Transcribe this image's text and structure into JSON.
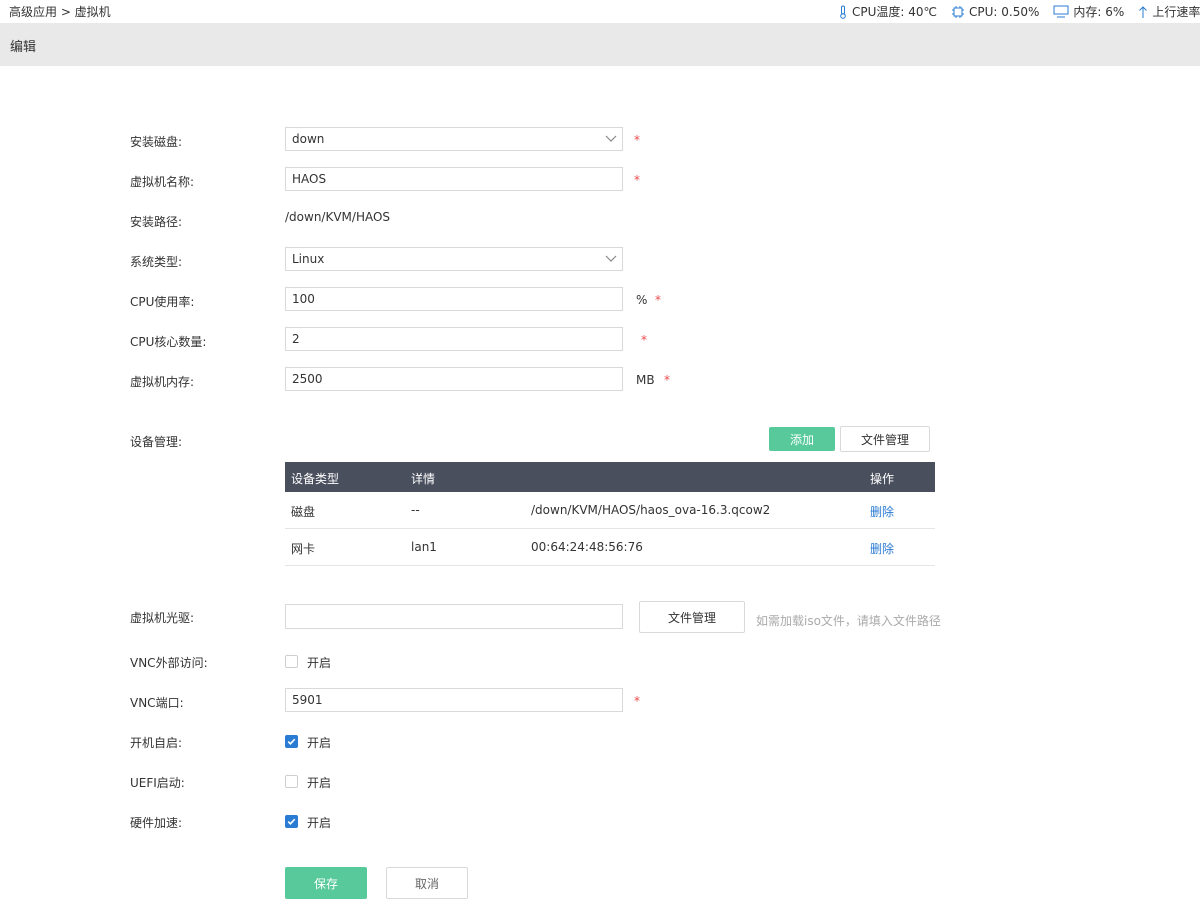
{
  "topbar": {
    "breadcrumb": "高级应用 > 虚拟机",
    "cpu_temp": "CPU温度: 40℃",
    "cpu_usage": "CPU: 0.50%",
    "memory": "内存: 6%",
    "upload": "上行速率"
  },
  "header": {
    "title": "编辑"
  },
  "form": {
    "install_disk": {
      "label": "安装磁盘:",
      "value": "down"
    },
    "vm_name": {
      "label": "虚拟机名称:",
      "value": "HAOS"
    },
    "install_path": {
      "label": "安装路径:",
      "value": "/down/KVM/HAOS"
    },
    "os_type": {
      "label": "系统类型:",
      "value": "Linux"
    },
    "cpu_rate": {
      "label": "CPU使用率:",
      "value": "100",
      "unit": "%"
    },
    "cpu_cores": {
      "label": "CPU核心数量:",
      "value": "2"
    },
    "vm_memory": {
      "label": "虚拟机内存:",
      "value": "2500",
      "unit": "MB"
    },
    "required_mark": "*"
  },
  "devices": {
    "label": "设备管理:",
    "add_button": "添加",
    "file_button": "文件管理",
    "columns": [
      "设备类型",
      "详情",
      "操作"
    ],
    "rows": [
      {
        "type": "磁盘",
        "detail1": "--",
        "detail2": "/down/KVM/HAOS/haos_ova-16.3.qcow2",
        "action": "删除"
      },
      {
        "type": "网卡",
        "detail1": "lan1",
        "detail2": "00:64:24:48:56:76",
        "action": "删除"
      }
    ]
  },
  "cdrom": {
    "label": "虚拟机光驱:",
    "value": "",
    "file_button": "文件管理",
    "hint": "如需加载iso文件，请填入文件路径"
  },
  "vnc_external": {
    "label": "VNC外部访问:",
    "option": "开启",
    "checked": false
  },
  "vnc_port": {
    "label": "VNC端口:",
    "value": "5901"
  },
  "autostart": {
    "label": "开机自启:",
    "option": "开启",
    "checked": true
  },
  "uefi": {
    "label": "UEFI启动:",
    "option": "开启",
    "checked": false
  },
  "hw_accel": {
    "label": "硬件加速:",
    "option": "开启",
    "checked": true
  },
  "actions": {
    "save": "保存",
    "cancel": "取消"
  },
  "colors": {
    "accent_green": "#57c99a",
    "table_header": "#4a4f5e",
    "link_blue": "#2a7bd3",
    "required_red": "#e94b4b"
  }
}
